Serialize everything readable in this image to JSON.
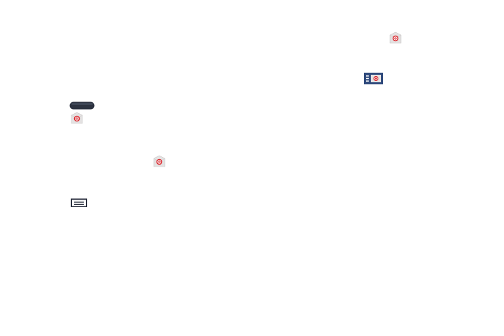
{
  "icons": {
    "email_app": "email-app-icon",
    "home_key": "home-key-icon",
    "menu_key": "menu-key-icon",
    "email_widget": "email-widget-icon"
  },
  "colors": {
    "email_red": "#d9262c",
    "tile_gray": "#e4e2e2",
    "widget_blue": "#2f4a7c",
    "key_dark": "#2c3240"
  }
}
